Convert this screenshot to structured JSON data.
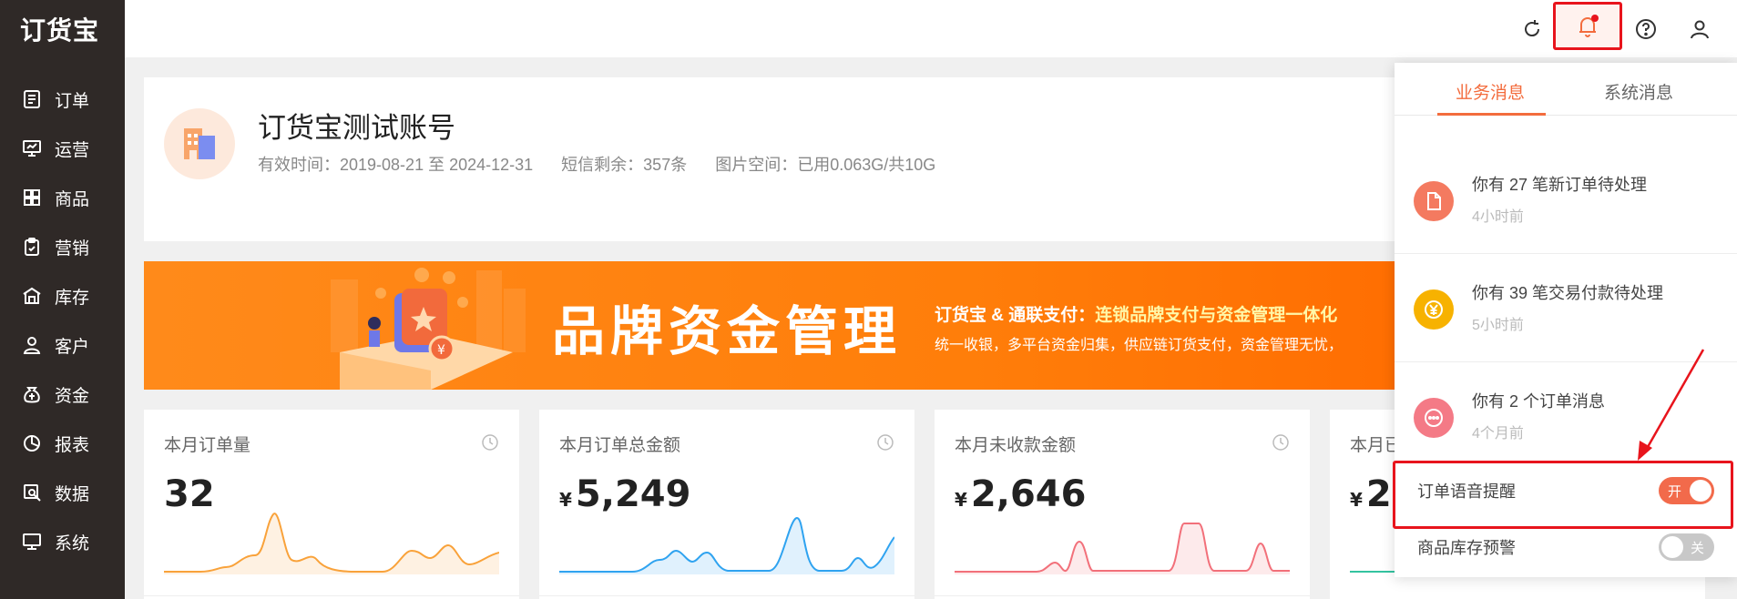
{
  "app": {
    "logo": "订货宝"
  },
  "sidebar": {
    "items": [
      {
        "label": "订单",
        "icon": "order-icon"
      },
      {
        "label": "运营",
        "icon": "operation-icon"
      },
      {
        "label": "商品",
        "icon": "product-icon"
      },
      {
        "label": "营销",
        "icon": "marketing-icon"
      },
      {
        "label": "库存",
        "icon": "inventory-icon"
      },
      {
        "label": "客户",
        "icon": "customer-icon"
      },
      {
        "label": "资金",
        "icon": "funds-icon"
      },
      {
        "label": "报表",
        "icon": "report-icon"
      },
      {
        "label": "数据",
        "icon": "data-icon"
      },
      {
        "label": "系统",
        "icon": "system-icon"
      }
    ]
  },
  "account": {
    "name": "订货宝测试账号",
    "valid_period": "有效时间：2019-08-21 至 2024-12-31",
    "sms_remaining": "短信剩余：357条",
    "image_space": "图片空间：已用0.063G/共10G"
  },
  "banner": {
    "title": "品牌资金管理",
    "subtitle_prefix": "订货宝 & 通联支付：",
    "subtitle_highlight": "连锁品牌支付与资金管理一体化",
    "line2": "统一收银，多平台资金归集，供应链订货支付，资金管理无忧，"
  },
  "stats": [
    {
      "label": "本月订单量",
      "currency": "",
      "value": "32",
      "color": "#f9a23a"
    },
    {
      "label": "本月订单总金额",
      "currency": "¥",
      "value": "5,249",
      "color": "#2fa3f0"
    },
    {
      "label": "本月未收款金额",
      "currency": "¥",
      "value": "2,646",
      "color": "#f2707a"
    },
    {
      "label": "本月已",
      "currency": "¥",
      "value": "2",
      "color": "#33c3a0"
    }
  ],
  "notifications": {
    "tabs": [
      "业务消息",
      "系统消息"
    ],
    "messages": [
      {
        "text": "你有 27 笔新订单待处理",
        "time": "4小时前",
        "icon": "document-icon",
        "color": "#f47a60"
      },
      {
        "text": "你有 39 笔交易付款待处理",
        "time": "5小时前",
        "icon": "yen-icon",
        "color": "#f7b200"
      },
      {
        "text": "你有 2 个订单消息",
        "time": "4个月前",
        "icon": "chat-icon",
        "color": "#f47a86"
      }
    ],
    "settings": [
      {
        "label": "订单语音提醒",
        "state": "开",
        "on": true
      },
      {
        "label": "商品库存预警",
        "state": "关",
        "on": false
      }
    ]
  }
}
